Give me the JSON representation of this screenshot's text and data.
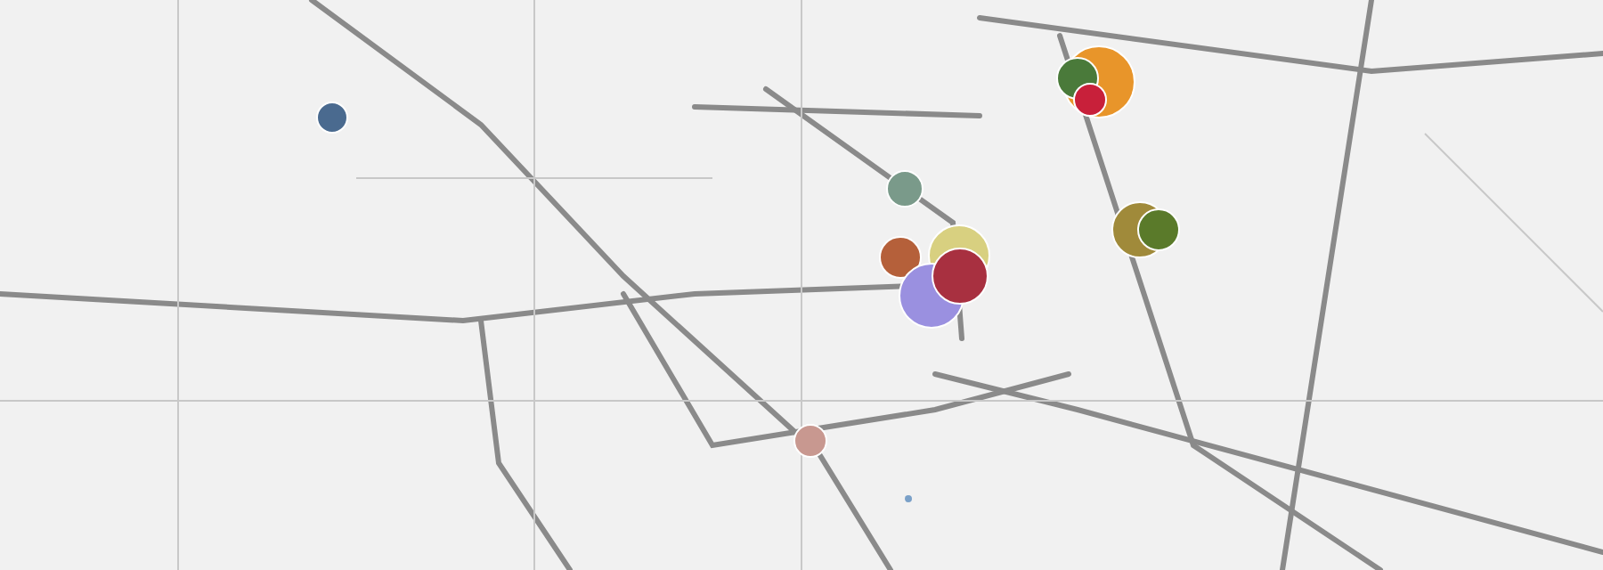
{
  "map": {
    "markers": [
      {
        "color": "#4a6a8f"
      },
      {
        "color": "#e8952a"
      },
      {
        "color": "#4a7a3a"
      },
      {
        "color": "#c8203a"
      },
      {
        "color": "#7a9a8a"
      },
      {
        "color": "#a08a3a"
      },
      {
        "color": "#5a7a2a"
      },
      {
        "color": "#b5603a"
      },
      {
        "color": "#d8d080"
      },
      {
        "color": "#9a90e0"
      },
      {
        "color": "#a83040"
      },
      {
        "color": "#c89890"
      },
      {
        "color": "#7aa0c8"
      }
    ]
  }
}
